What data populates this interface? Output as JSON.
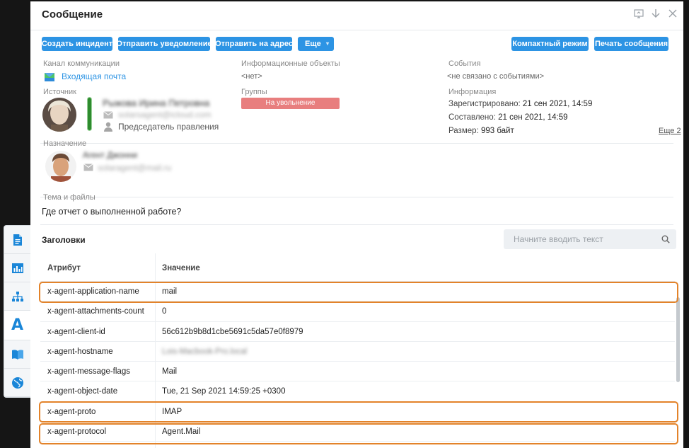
{
  "dialog": {
    "title": "Сообщение"
  },
  "toolbar": {
    "create_incident": "Создать инцидент",
    "send_notification": "Отправить уведомление",
    "send_to_address": "Отправить на адрес",
    "more": "Еще",
    "compact_mode": "Компактный режим",
    "print_message": "Печать сообщения"
  },
  "info": {
    "channel_label": "Канал коммуникации",
    "channel_value": "Входящая почта",
    "info_objects_label": "Информационные объекты",
    "info_objects_value": "<нет>",
    "events_label": "События",
    "events_value": "<не связано с событиями>",
    "source_label": "Источник",
    "source_name": "Рыжова Ирина Петровна",
    "source_email": "solarsagent@icloud.com",
    "source_position": "Председатель правления",
    "groups_label": "Группы",
    "group_badge": "На увольнение",
    "information_label": "Информация",
    "registered_label": "Зарегистрировано:",
    "registered_value": "21 сен 2021, 14:59",
    "composed_label": "Составлено:",
    "composed_value": "21 сен 2021, 14:59",
    "size_label": "Размер:",
    "size_value": "993 байт",
    "more_link": "Еще 2",
    "destination_label": "Назначение",
    "destination_name": "Агент Джонни",
    "destination_email": "solaragent@mail.ru",
    "subject_label": "Тема и файлы",
    "subject_value": "Где отчет о выполненной работе?"
  },
  "headers": {
    "title": "Заголовки",
    "search_placeholder": "Начните вводить текст",
    "col_attribute": "Атрибут",
    "col_value": "Значение",
    "rows": [
      {
        "attr": "x-agent-application-name",
        "value": "mail"
      },
      {
        "attr": "x-agent-attachments-count",
        "value": "0"
      },
      {
        "attr": "x-agent-client-id",
        "value": "56c612b9b8d1cbe5691c5da57e0f8979"
      },
      {
        "attr": "x-agent-hostname",
        "value": "Lois-Macbook-Pro.local"
      },
      {
        "attr": "x-agent-message-flags",
        "value": "Mail"
      },
      {
        "attr": "x-agent-object-date",
        "value": "Tue, 21 Sep 2021 14:59:25 +0300"
      },
      {
        "attr": "x-agent-proto",
        "value": "IMAP"
      },
      {
        "attr": "x-agent-protocol",
        "value": "Agent.Mail"
      }
    ]
  },
  "colors": {
    "accent": "#2d94e4",
    "highlight": "#e3832a",
    "badge": "#e87e7e",
    "status": "#2e8b2e"
  },
  "icons": {
    "leftbar": [
      "document-icon",
      "chart-icon",
      "hierarchy-icon",
      "font-a-icon",
      "book-icon",
      "globe-icon"
    ]
  }
}
